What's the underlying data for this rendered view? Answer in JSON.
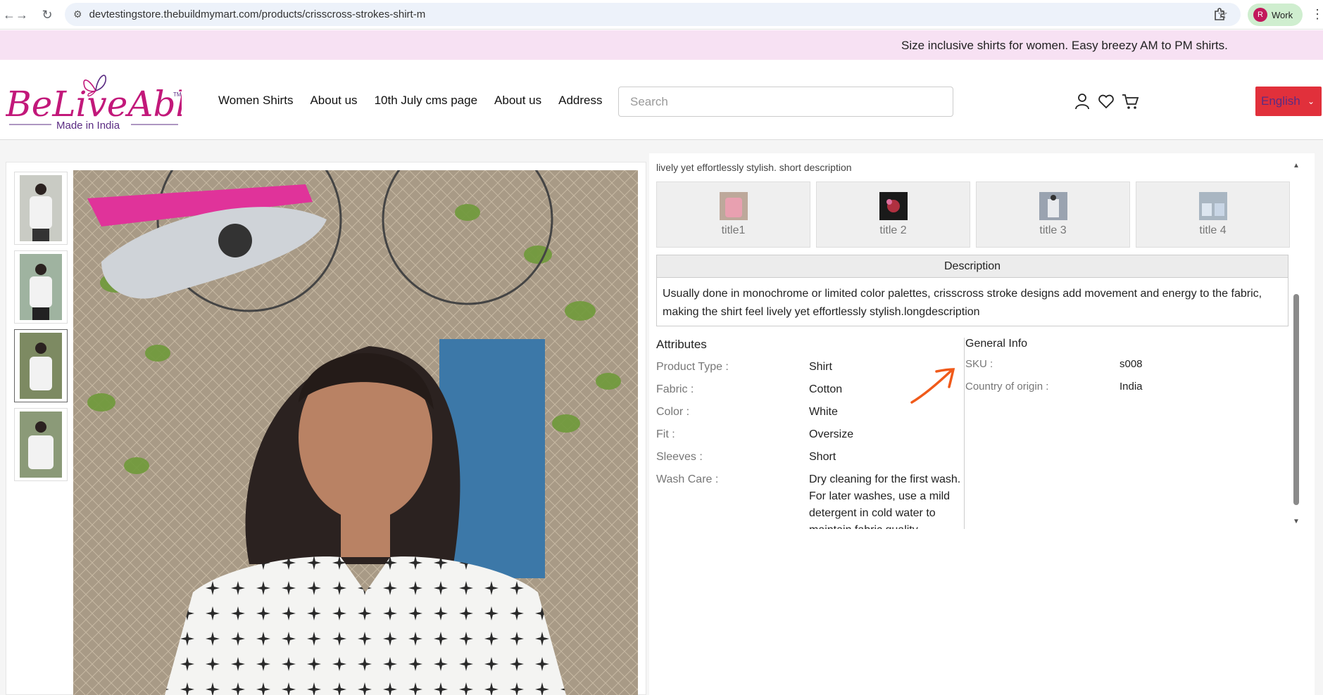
{
  "browser": {
    "url": "devtestingstore.thebuildmymart.com/products/crisscross-strokes-shirt-m",
    "profile_initial": "R",
    "profile_label": "Work"
  },
  "announcement": "Size inclusive shirts for women. Easy breezy AM to PM shirts.",
  "header": {
    "logo_text": "BeLiveAble",
    "logo_tm": "TM",
    "logo_tagline": "Made in India",
    "menu": [
      "Women Shirts",
      "About us",
      "10th July cms page",
      "About us",
      "Address"
    ],
    "search_placeholder": "Search",
    "language": "English"
  },
  "product": {
    "short_description": "lively yet effortlessly stylish. short description",
    "tiles": [
      {
        "label": "title1"
      },
      {
        "label": "title 2"
      },
      {
        "label": "title 3"
      },
      {
        "label": "title 4"
      }
    ],
    "description_heading": "Description",
    "description_text": "Usually done in monochrome or limited color palettes, crisscross stroke designs add movement and energy to the fabric, making the shirt feel lively yet effortlessly stylish.longdescription",
    "attributes_heading": "Attributes",
    "attributes": [
      {
        "key": "Product Type :",
        "value": "Shirt"
      },
      {
        "key": "Fabric :",
        "value": "Cotton"
      },
      {
        "key": "Color :",
        "value": "White"
      },
      {
        "key": "Fit :",
        "value": "Oversize"
      },
      {
        "key": "Sleeves :",
        "value": "Short"
      },
      {
        "key": "Wash Care :",
        "value": "Dry cleaning for the first wash. For later washes, use a mild detergent in cold water to maintain fabric quality."
      }
    ],
    "general_heading": "General Info",
    "general": [
      {
        "key": "SKU :",
        "value": "s008"
      },
      {
        "key": "Country of origin :",
        "value": "India"
      }
    ]
  },
  "colors": {
    "announcement_bg": "#f7e1f3",
    "logo_magenta": "#c2187a",
    "logo_purple": "#5b2c83",
    "lang_bg": "#e1303b",
    "annotation_arrow": "#f05a1a"
  }
}
